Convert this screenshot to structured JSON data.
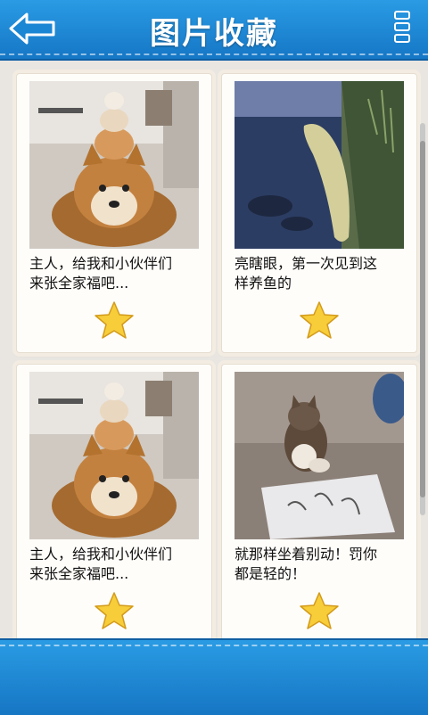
{
  "header": {
    "title": "图片收藏",
    "back_icon": "back-arrow-icon",
    "menu_icon": "menu-icon"
  },
  "colors": {
    "header_bg": "#1a86d4",
    "star_fill": "#f7cd3a"
  },
  "favorites": [
    {
      "caption_line1": "主人，给我和小伙伴们",
      "caption_line2": "来张全家福吧...",
      "photo": "shiba-dogs-photo",
      "starred": true
    },
    {
      "caption_line1": "亮瞎眼，第一次见到这",
      "caption_line2": "样养鱼的",
      "photo": "fish-photo",
      "starred": true
    },
    {
      "caption_line1": "主人，给我和小伙伴们",
      "caption_line2": "来张全家福吧...",
      "photo": "shiba-dogs-photo",
      "starred": true
    },
    {
      "caption_line1": "就那样坐着别动！罚你",
      "caption_line2": "都是轻的！",
      "photo": "cat-photo",
      "starred": true
    }
  ]
}
